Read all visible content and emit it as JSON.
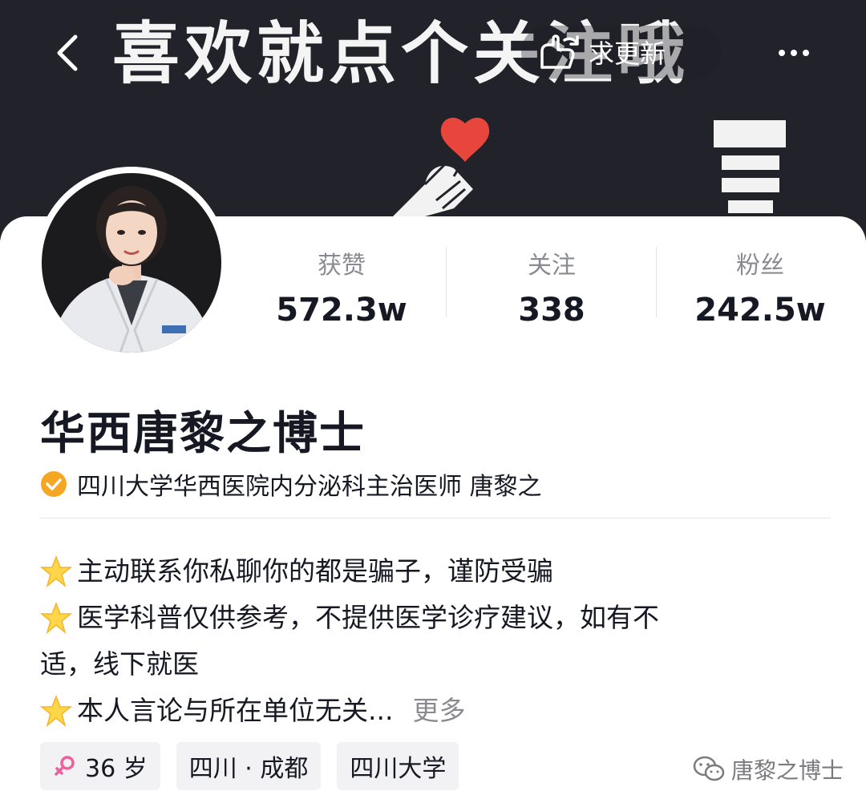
{
  "banner": {
    "text": "喜欢就点个关注哦"
  },
  "nav": {
    "pill_label": "求更新",
    "back_icon": "chevron-left-icon",
    "pill_icon": "refresh-hand-icon",
    "more_icon": "more-dots-icon"
  },
  "profile": {
    "name": "华西唐黎之博士",
    "verification": "四川大学华西医院内分泌科主治医师 唐黎之",
    "verified_icon_color": "#f5a623"
  },
  "stats": [
    {
      "label": "获赞",
      "value": "572.3w"
    },
    {
      "label": "关注",
      "value": "338"
    },
    {
      "label": "粉丝",
      "value": "242.5w"
    }
  ],
  "bio": {
    "line1": "主动联系你私聊你的都是骗子，谨防受骗",
    "line2a": "医学科普仅供参考，不提供医学诊疗建议，如有不",
    "line2b": "适，线下就医",
    "line3": "本人言论与所在单位无关...",
    "more": "更多"
  },
  "tags": {
    "age": "36 岁",
    "location": "四川 · 成都",
    "school": "四川大学",
    "gender_icon_color": "#f0609c"
  },
  "watermark": {
    "text": "唐黎之博士"
  },
  "colors": {
    "banner_bg": "#22222a",
    "heart": "#e8463c",
    "muted_text": "#8a8b91"
  }
}
